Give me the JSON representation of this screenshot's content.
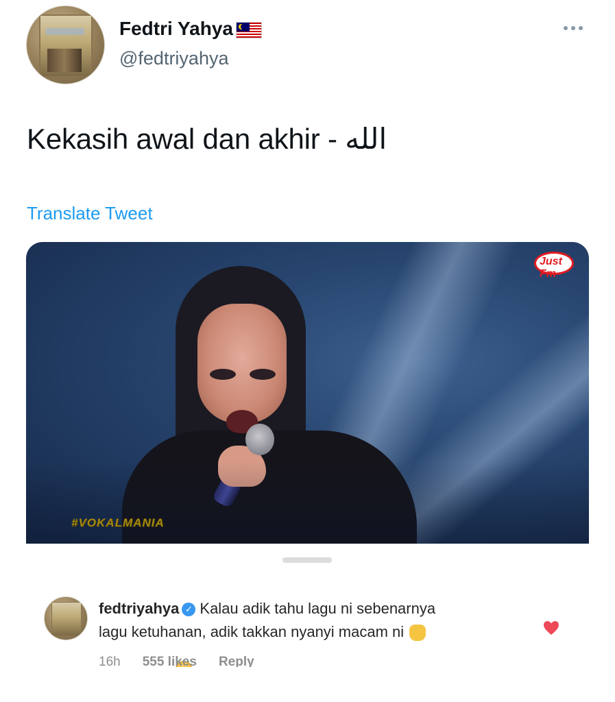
{
  "tweet": {
    "display_name": "Fedtri Yahya",
    "flag_icon": "malaysia-flag-icon",
    "handle": "@fedtriyahya",
    "text": "Kekasih awal dan akhir - الله",
    "translate_label": "Translate Tweet",
    "more_icon": "more-options-icon",
    "link_color": "#1d9bf0"
  },
  "media": {
    "channel_logo_text": "Just Fm",
    "hashtag_overlay": "#VOKALMANIA"
  },
  "comment": {
    "username": "fedtriyahya",
    "verified_icon": "verified-badge-icon",
    "text_line1": "Kalau adik tahu lagu ni sebenarnya",
    "text_line2": "lagu ketuhanan, adik takkan nyanyi macam ni",
    "emojis": [
      "raised-hands-emoji",
      "flushed-face-emoji"
    ],
    "time": "16h",
    "likes": "555 likes",
    "reply_label": "Reply",
    "heart_color": "#ed4956"
  }
}
